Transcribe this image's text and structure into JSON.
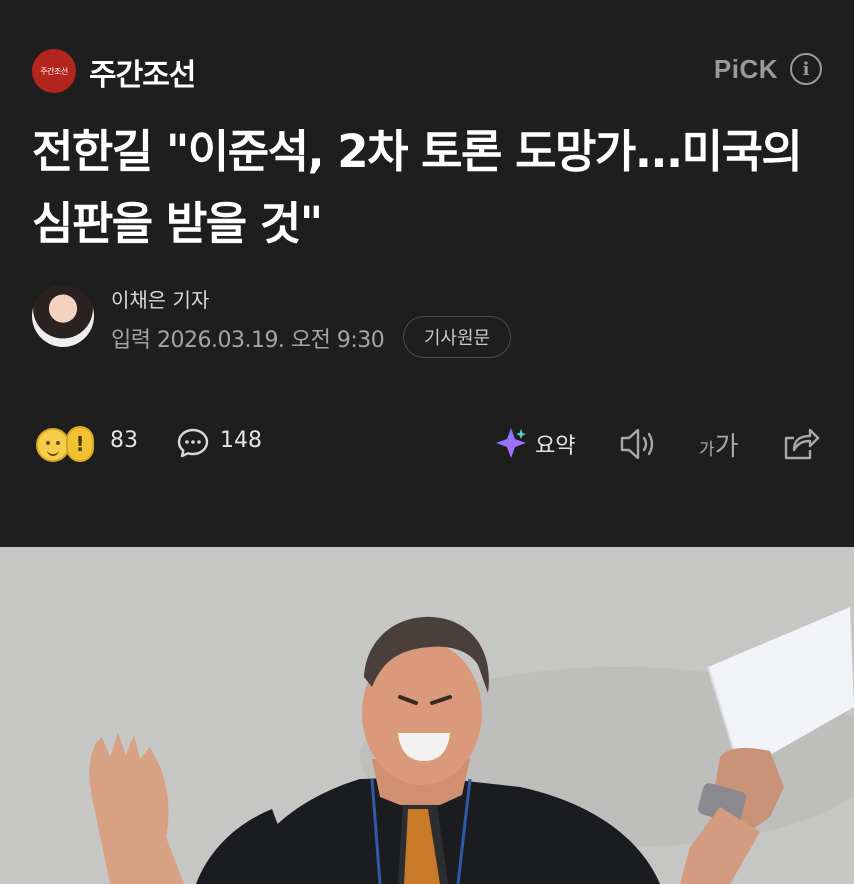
{
  "press": {
    "logo_text": "주간조선",
    "name": "주간조선",
    "pick_label": "PiCK",
    "info_glyph": "i"
  },
  "headline": "전한길 \"이준석, 2차 토론 도망가...미국의 심판을 받을 것\"",
  "reporter": {
    "name": "이채은 기자",
    "published": "입력 2026.03.19. 오전 9:30",
    "original_button": "기사원문"
  },
  "actions": {
    "reaction_count": "83",
    "comment_count": "148",
    "summary_label": "요약",
    "font_small": "가",
    "font_large": "가"
  },
  "colors": {
    "background": "#1e1e1f",
    "logo_red": "#b3261e",
    "muted_text": "#a5a5a7"
  },
  "icons": [
    "info-icon",
    "reaction-emoji-icons",
    "comment-icon",
    "ai-summary-icon",
    "speaker-icon",
    "font-size-icon",
    "share-icon"
  ]
}
